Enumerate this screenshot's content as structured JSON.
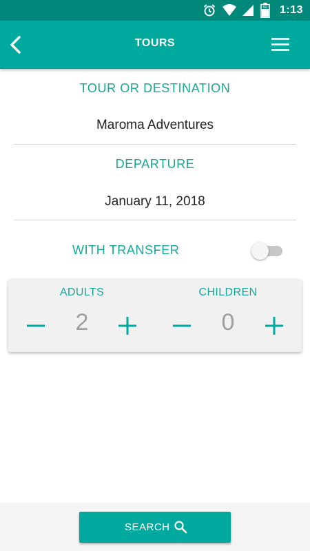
{
  "status_bar": {
    "time": "1:13",
    "battery_level": "60"
  },
  "app_bar": {
    "title": "TOURS"
  },
  "form": {
    "destination_label": "TOUR OR DESTINATION",
    "destination_value": "Maroma Adventures",
    "departure_label": "DEPARTURE",
    "departure_value": "January 11, 2018",
    "transfer_label": "WITH TRANSFER",
    "transfer_enabled": false
  },
  "passengers": {
    "adults_label": "ADULTS",
    "adults_count": "2",
    "children_label": "CHILDREN",
    "children_count": "0"
  },
  "search": {
    "label": "SEARCH"
  },
  "colors": {
    "primary": "#00a99d",
    "status_bar": "#00897b",
    "accent_text": "#17a69a",
    "count_text": "#9e9e9e"
  },
  "icons": [
    "alarm-icon",
    "wifi-icon",
    "signal-icon",
    "battery-icon",
    "back-icon",
    "menu-icon",
    "minus-icon",
    "plus-icon",
    "search-icon"
  ]
}
